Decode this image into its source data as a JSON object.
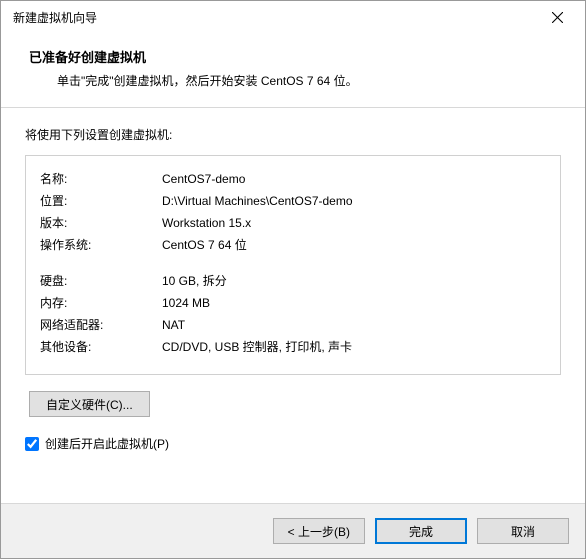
{
  "window": {
    "title": "新建虚拟机向导"
  },
  "header": {
    "title": "已准备好创建虚拟机",
    "subtitle": "单击\"完成\"创建虚拟机，然后开始安装 CentOS 7 64 位。"
  },
  "content": {
    "intro": "将使用下列设置创建虚拟机:",
    "rows": [
      {
        "label": "名称:",
        "value": "CentOS7-demo"
      },
      {
        "label": "位置:",
        "value": "D:\\Virtual Machines\\CentOS7-demo"
      },
      {
        "label": "版本:",
        "value": "Workstation 15.x"
      },
      {
        "label": "操作系统:",
        "value": "CentOS 7 64 位"
      }
    ],
    "rows2": [
      {
        "label": "硬盘:",
        "value": "10 GB, 拆分"
      },
      {
        "label": "内存:",
        "value": "1024 MB"
      },
      {
        "label": "网络适配器:",
        "value": "NAT"
      },
      {
        "label": "其他设备:",
        "value": "CD/DVD, USB 控制器, 打印机, 声卡"
      }
    ],
    "customize_label": "自定义硬件(C)...",
    "checkbox_label": "创建后开启此虚拟机(P)",
    "checkbox_checked": true
  },
  "footer": {
    "back": "< 上一步(B)",
    "finish": "完成",
    "cancel": "取消"
  }
}
